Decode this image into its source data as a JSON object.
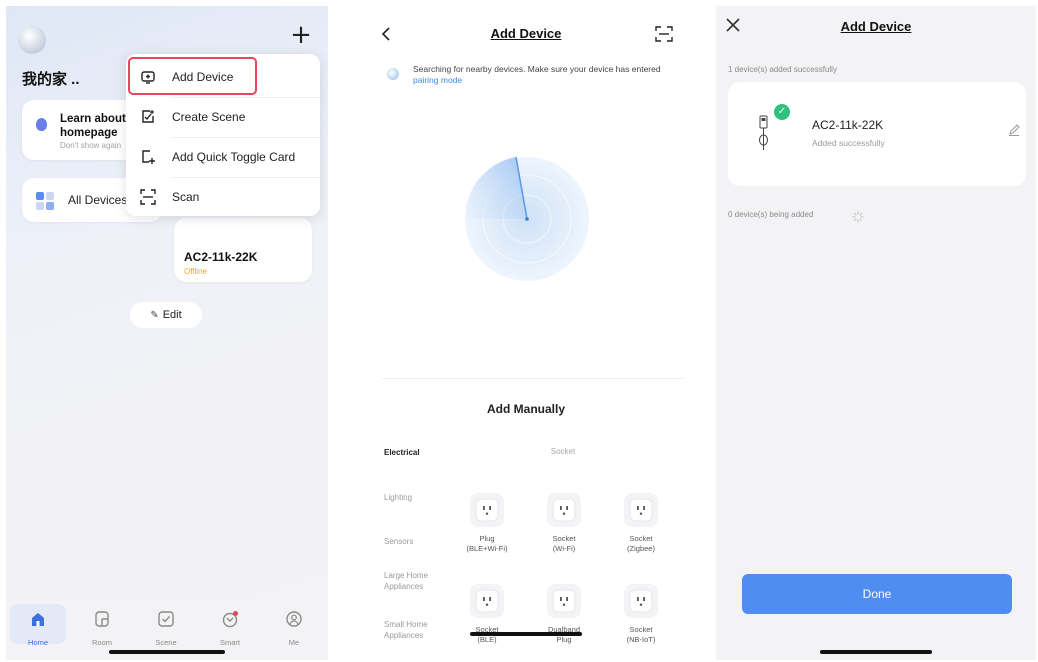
{
  "screen1": {
    "home_title": "我的家 ..",
    "learn_card": {
      "title": "Learn about DIY homepage",
      "subtitle": "Don't show again"
    },
    "all_devices_label": "All Devices",
    "device_card": {
      "name": "AC2-11k-22K",
      "status": "Offline"
    },
    "edit_label": "Edit",
    "menu": [
      {
        "label": "Add Device",
        "icon": "add-device-icon"
      },
      {
        "label": "Create Scene",
        "icon": "create-scene-icon"
      },
      {
        "label": "Add Quick Toggle Card",
        "icon": "quick-toggle-icon"
      },
      {
        "label": "Scan",
        "icon": "scan-icon"
      }
    ],
    "tabs": [
      {
        "label": "Home",
        "icon": "home-icon",
        "active": true
      },
      {
        "label": "Room",
        "icon": "room-icon",
        "active": false
      },
      {
        "label": "Scene",
        "icon": "scene-icon",
        "active": false
      },
      {
        "label": "Smart",
        "icon": "smart-icon",
        "active": false
      },
      {
        "label": "Me",
        "icon": "me-icon",
        "active": false
      }
    ],
    "colors": {
      "accent": "#3c6fe0",
      "highlight": "#e5475b",
      "offline": "#f5a623"
    }
  },
  "screen2": {
    "title": "Add Device",
    "notice_text": "Searching for nearby devices. Make sure your device has entered",
    "notice_link": "pairing mode",
    "manual_title": "Add Manually",
    "categories": [
      "Electrical",
      "Lighting",
      "Sensors",
      "Large Home Appliances",
      "Small Home Appliances"
    ],
    "selected_category": "Electrical",
    "column_header": "Socket",
    "products": [
      {
        "label_line1": "Plug",
        "label_line2": "(BLE+Wi-Fi)"
      },
      {
        "label_line1": "Socket",
        "label_line2": "(Wi-Fi)"
      },
      {
        "label_line1": "Socket",
        "label_line2": "(Zigbee)"
      },
      {
        "label_line1": "Socket",
        "label_line2": "(BLE)"
      },
      {
        "label_line1": "Dualband",
        "label_line2": "Plug"
      },
      {
        "label_line1": "Socket",
        "label_line2": "(NB-IoT)"
      }
    ]
  },
  "screen3": {
    "title": "Add Device",
    "added_count_text": "1 device(s) added successfully",
    "device_name": "AC2-11k-22K",
    "device_status": "Added successfully",
    "adding_text": "0 device(s) being added",
    "done_label": "Done",
    "colors": {
      "done_button": "#4f8ef0",
      "success": "#2ec27e"
    }
  }
}
